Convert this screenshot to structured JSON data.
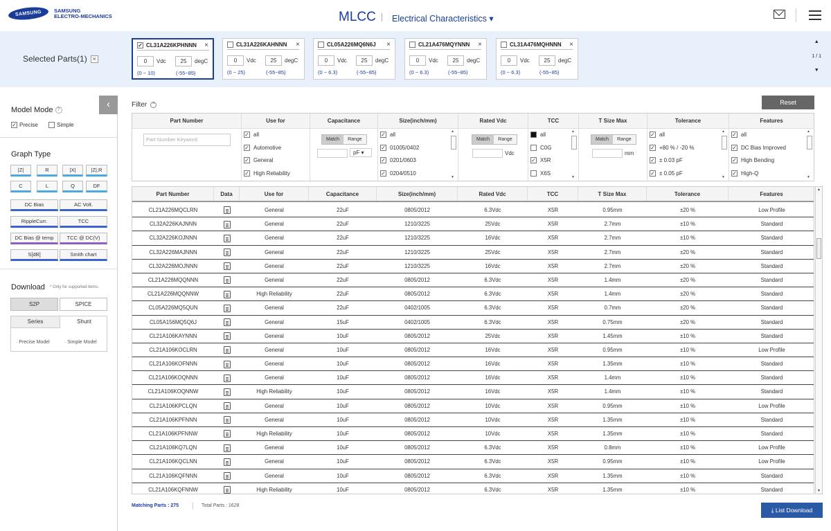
{
  "header": {
    "brand": "SAMSUNG",
    "brand_sub1": "SAMSUNG",
    "brand_sub2": "ELECTRO-MECHANICS",
    "title": "MLCC",
    "subtitle": "Electrical Characteristics ▾"
  },
  "selected": {
    "label": "Selected Parts(1)",
    "close": "×",
    "pager": "1 / 1",
    "cards": [
      {
        "name": "CL31A226KPHNNN",
        "checked": "✓",
        "v": "0",
        "v_unit": "Vdc",
        "t": "25",
        "t_unit": "degC",
        "v_range": "(0 ~ 10)",
        "t_range": "(-55~85)"
      },
      {
        "name": "CL31A226KAHNNN",
        "checked": "",
        "v": "0",
        "v_unit": "Vdc",
        "t": "25",
        "t_unit": "degC",
        "v_range": "(0 ~ 25)",
        "t_range": "(-55~85)"
      },
      {
        "name": "CL05A226MQ6N6J",
        "checked": "",
        "v": "0",
        "v_unit": "Vdc",
        "t": "25",
        "t_unit": "degC",
        "v_range": "(0 ~ 6.3)",
        "t_range": "(-55~85)"
      },
      {
        "name": "CL21A476MQYNNN",
        "checked": "",
        "v": "0",
        "v_unit": "Vdc",
        "t": "25",
        "t_unit": "degC",
        "v_range": "(0 ~ 6.3)",
        "t_range": "(-55~85)"
      },
      {
        "name": "CL31A476MQHNNN",
        "checked": "",
        "v": "0",
        "v_unit": "Vdc",
        "t": "25",
        "t_unit": "degC",
        "v_range": "(0 ~ 6.3)",
        "t_range": "(-55~85)"
      }
    ]
  },
  "sidebar": {
    "model_mode": "Model Mode",
    "help": "?",
    "precise": "Precise",
    "simple": "Simple",
    "graph_type": "Graph Type",
    "buttons": [
      "|Z|",
      "R",
      "|X|",
      "|Z|,R",
      "C",
      "L",
      "Q",
      "DF",
      "DC Bias",
      "AC Volt.",
      "RippleCurr.",
      "TCC",
      "DC Bias @ temp",
      "TCC @ DC(V)",
      "S[dB]",
      "Smith chart"
    ],
    "download": "Download",
    "note": "* Only for supported items.",
    "s2p": "S2P",
    "spice": "SPICE",
    "series": "Series",
    "shunt": "Shunt",
    "precise_model": "· Precise Model",
    "simple_model": "· Simple Model"
  },
  "filter": {
    "title": "Filter",
    "reset": "Reset",
    "kw_placeholder": "Part Number Keyword",
    "match": "Match",
    "range": "Range",
    "pf": "pF ▾",
    "vdc": "Vdc",
    "mm": "mm",
    "headers": [
      "Part Number",
      "Use for",
      "Capacitance",
      "Size(inch/mm)",
      "Rated Vdc",
      "TCC",
      "T Size Max",
      "Tolerance",
      "Features"
    ],
    "use_for": [
      "all",
      "Automotive",
      "General",
      "High Reliability"
    ],
    "size": [
      "all",
      "01005/0402",
      "0201/0603",
      "0204/0510"
    ],
    "tcc": [
      "all",
      "C0G",
      "X5R",
      "X6S"
    ],
    "tolerance": [
      "all",
      "+80 % / -20 %",
      "± 0.03 pF",
      "± 0.05 pF"
    ],
    "features": [
      "all",
      "DC Bias Improved",
      "High Bending",
      "High-Q"
    ]
  },
  "table": {
    "headers": [
      "Part Number",
      "Data",
      "Use for",
      "Capacitance",
      "Size(inch/mm)",
      "Rated Vdc",
      "TCC",
      "T Size Max",
      "Tolerance",
      "Features"
    ],
    "rows": [
      [
        "CL21A226MQCLRN",
        "General",
        "22uF",
        "0805/2012",
        "6.3Vdc",
        "X5R",
        "0.95mm",
        "±20 %",
        "Low Profile"
      ],
      [
        "CL32A226KAJNNN",
        "General",
        "22uF",
        "1210/3225",
        "25Vdc",
        "X5R",
        "2.7mm",
        "±10 %",
        "Standard"
      ],
      [
        "CL32A226KOJNNN",
        "General",
        "22uF",
        "1210/3225",
        "16Vdc",
        "X5R",
        "2.7mm",
        "±10 %",
        "Standard"
      ],
      [
        "CL32A226MAJNNN",
        "General",
        "22uF",
        "1210/3225",
        "25Vdc",
        "X5R",
        "2.7mm",
        "±20 %",
        "Standard"
      ],
      [
        "CL32A226MOJNNN",
        "General",
        "22uF",
        "1210/3225",
        "16Vdc",
        "X5R",
        "2.7mm",
        "±20 %",
        "Standard"
      ],
      [
        "CL21A226MQQNNN",
        "General",
        "22uF",
        "0805/2012",
        "6.3Vdc",
        "X5R",
        "1.4mm",
        "±20 %",
        "Standard"
      ],
      [
        "CL21A226MQQNNW",
        "High Reliability",
        "22uF",
        "0805/2012",
        "6.3Vdc",
        "X5R",
        "1.4mm",
        "±20 %",
        "Standard"
      ],
      [
        "CL05A226MQ5QUN",
        "General",
        "22uF",
        "0402/1005",
        "6.3Vdc",
        "X5R",
        "0.7mm",
        "±20 %",
        "Standard"
      ],
      [
        "CL05A156MQ5Q6J",
        "General",
        "15uF",
        "0402/1005",
        "6.3Vdc",
        "X5R",
        "0.75mm",
        "±20 %",
        "Standard"
      ],
      [
        "CL21A106KAYNNN",
        "General",
        "10uF",
        "0805/2012",
        "25Vdc",
        "X5R",
        "1.45mm",
        "±10 %",
        "Standard"
      ],
      [
        "CL21A106KOCLRN",
        "General",
        "10uF",
        "0805/2012",
        "16Vdc",
        "X5R",
        "0.95mm",
        "±10 %",
        "Low Profile"
      ],
      [
        "CL21A106KOFNNN",
        "General",
        "10uF",
        "0805/2012",
        "16Vdc",
        "X5R",
        "1.35mm",
        "±10 %",
        "Standard"
      ],
      [
        "CL21A106KOQNNN",
        "General",
        "10uF",
        "0805/2012",
        "16Vdc",
        "X5R",
        "1.4mm",
        "±10 %",
        "Standard"
      ],
      [
        "CL21A106KOQNNW",
        "High Reliability",
        "10uF",
        "0805/2012",
        "16Vdc",
        "X5R",
        "1.4mm",
        "±10 %",
        "Standard"
      ],
      [
        "CL21A106KPCLQN",
        "General",
        "10uF",
        "0805/2012",
        "10Vdc",
        "X5R",
        "0.95mm",
        "±10 %",
        "Low Profile"
      ],
      [
        "CL21A106KPFNNN",
        "General",
        "10uF",
        "0805/2012",
        "10Vdc",
        "X5R",
        "1.35mm",
        "±10 %",
        "Standard"
      ],
      [
        "CL21A106KPFNNW",
        "High Reliability",
        "10uF",
        "0805/2012",
        "10Vdc",
        "X5R",
        "1.35mm",
        "±10 %",
        "Standard"
      ],
      [
        "CL21A106KQ7LQN",
        "General",
        "10uF",
        "0805/2012",
        "6.3Vdc",
        "X5R",
        "0.8mm",
        "±10 %",
        "Low Profile"
      ],
      [
        "CL21A106KQCLNN",
        "General",
        "10uF",
        "0805/2012",
        "6.3Vdc",
        "X5R",
        "0.95mm",
        "±10 %",
        "Low Profile"
      ],
      [
        "CL21A106KQFNNN",
        "General",
        "10uF",
        "0805/2012",
        "6.3Vdc",
        "X5R",
        "1.35mm",
        "±10 %",
        "Standard"
      ],
      [
        "CL21A106KQFNNW",
        "High Reliability",
        "10uF",
        "0805/2012",
        "6.3Vdc",
        "X5R",
        "1.35mm",
        "±10 %",
        "Standard"
      ]
    ]
  },
  "footer": {
    "matching": "Matching Parts : 275",
    "total": "Total Parts : 1628",
    "download": "⤓  List Download"
  },
  "colors": {
    "brand": "#1a3d9a",
    "band": "#e8f0fb",
    "download_btn": "#2a5aa5"
  }
}
